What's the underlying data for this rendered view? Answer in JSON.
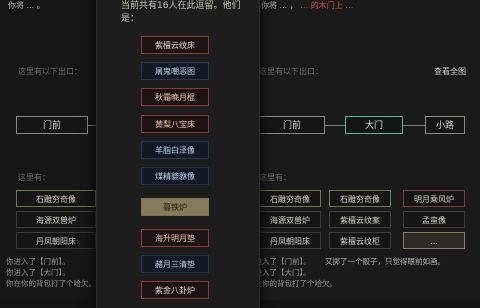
{
  "left": {
    "top_text": "你将 ... 。",
    "exit_title": "这里有以下出口：",
    "exits": [
      {
        "label": "门前"
      }
    ],
    "here_label": "这里有：",
    "items": [
      "石雕穷奇像",
      "海源双兽炉",
      "丹凤朝阳床"
    ],
    "log": [
      "你进入了【门前】。",
      "你进入了【大门】。",
      "你在你的背包打了个哈欠。"
    ]
  },
  "right": {
    "top_text_a": "你将 ... ，",
    "top_text_b": "… 的木门上 …",
    "exit_title": "这里有以下出口：",
    "view_all": "查看全图",
    "exits": [
      {
        "label": "门前"
      },
      {
        "label": "大门"
      },
      {
        "label": "小路"
      }
    ],
    "here_label": "这里有：",
    "items": [
      [
        "石雕穷奇像",
        "石雕穷奇像",
        "明月乘风炉"
      ],
      [
        "海源双兽炉",
        "紫檀云纹案",
        "孟蛮像"
      ],
      [
        "丹凤朝阳床",
        "紫檀云纹柜",
        "…"
      ]
    ],
    "log": [
      "你进入了【门前】。",
      "你进入了【大门】。",
      "你在你的背包打了个哈欠。",
      "又掷了一个骰子，只觉得眼前如画。"
    ]
  },
  "dialog": {
    "description": "当前共有16人在此逗留。他们是：",
    "options": [
      {
        "label": "紫檀云纹床",
        "style": "red"
      },
      {
        "label": "屠鬼嘲恶图",
        "style": "blue"
      },
      {
        "label": "秋霜晚月棍",
        "style": "red orange"
      },
      {
        "label": "黄梨八宝床",
        "style": "red orange"
      },
      {
        "label": "羊脂白泽像",
        "style": "blue"
      },
      {
        "label": "煤精貔貅像",
        "style": "blue"
      },
      {
        "label": "暮铁炉",
        "style": "gold"
      },
      {
        "label": "海升明月垫",
        "style": "red orange"
      },
      {
        "label": "赭月三清垫",
        "style": "blue"
      },
      {
        "label": "紫金八卦炉",
        "style": "red"
      }
    ]
  },
  "colors": {
    "accent_green": "#4fb59d",
    "red_border": "#8c3a2c",
    "blue_border": "#24384f",
    "gold": "#847b5c"
  }
}
